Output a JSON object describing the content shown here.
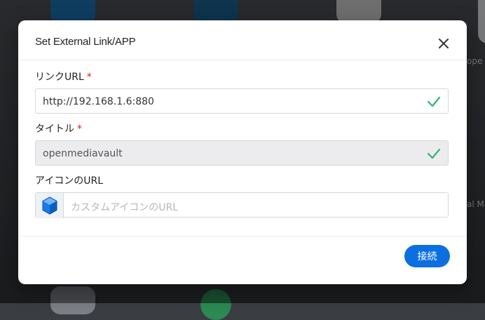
{
  "background": {
    "right_label_1": "ope",
    "right_label_2": "al M"
  },
  "dialog": {
    "title": "Set External Link/APP",
    "close_icon": "close-icon",
    "fields": {
      "link_url": {
        "label": "リンクURL",
        "required_mark": "*",
        "value": "http://192.168.1.6:880",
        "valid": true
      },
      "title": {
        "label": "タイトル",
        "required_mark": "*",
        "value": "openmediavault",
        "valid": true
      },
      "icon_url": {
        "label": "アイコンのURL",
        "placeholder": "カスタムアイコンのURL",
        "icon": "cube-icon"
      }
    },
    "connect_label": "接続"
  },
  "colors": {
    "primary": "#0b6fe0",
    "success": "#2bb673",
    "required": "#e02020"
  }
}
